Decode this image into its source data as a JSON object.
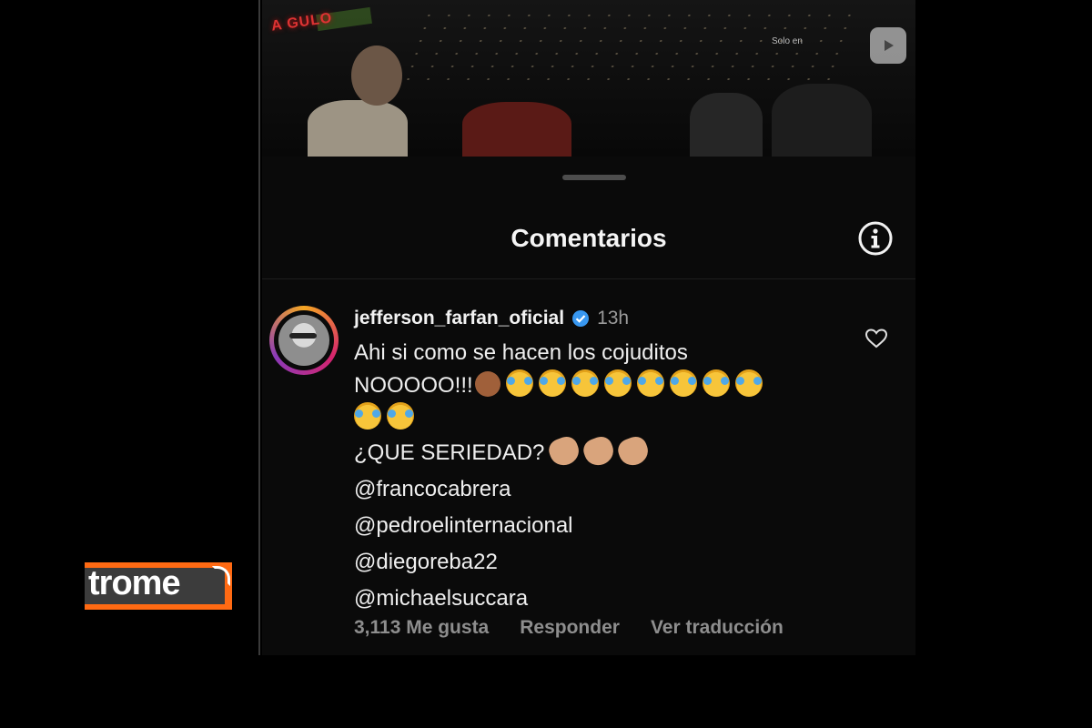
{
  "video": {
    "neon_text": "A GULO",
    "broadcaster_text": "Solo en"
  },
  "sheet": {
    "title": "Comentarios"
  },
  "comment": {
    "username": "jefferson_farfan_oficial",
    "verified": true,
    "time": "13h",
    "line1": "Ahi si como se hacen los cojuditos",
    "line2": "NOOOOO!!!",
    "line4": "¿QUE SERIEDAD?",
    "mentions": [
      "@francocabrera",
      "@pedroelinternacional",
      "@diegoreba22",
      "@michaelsuccara"
    ],
    "likes_label": "3,113 Me gusta",
    "reply_label": "Responder",
    "translate_label": "Ver traducción"
  },
  "watermark": {
    "logo_text": "trome"
  },
  "colors": {
    "background": "#000000",
    "sheet": "#0a0a0a",
    "verified": "#3897f0",
    "secondary_text": "#8e8e8e",
    "brand_orange": "#ff6a13"
  }
}
